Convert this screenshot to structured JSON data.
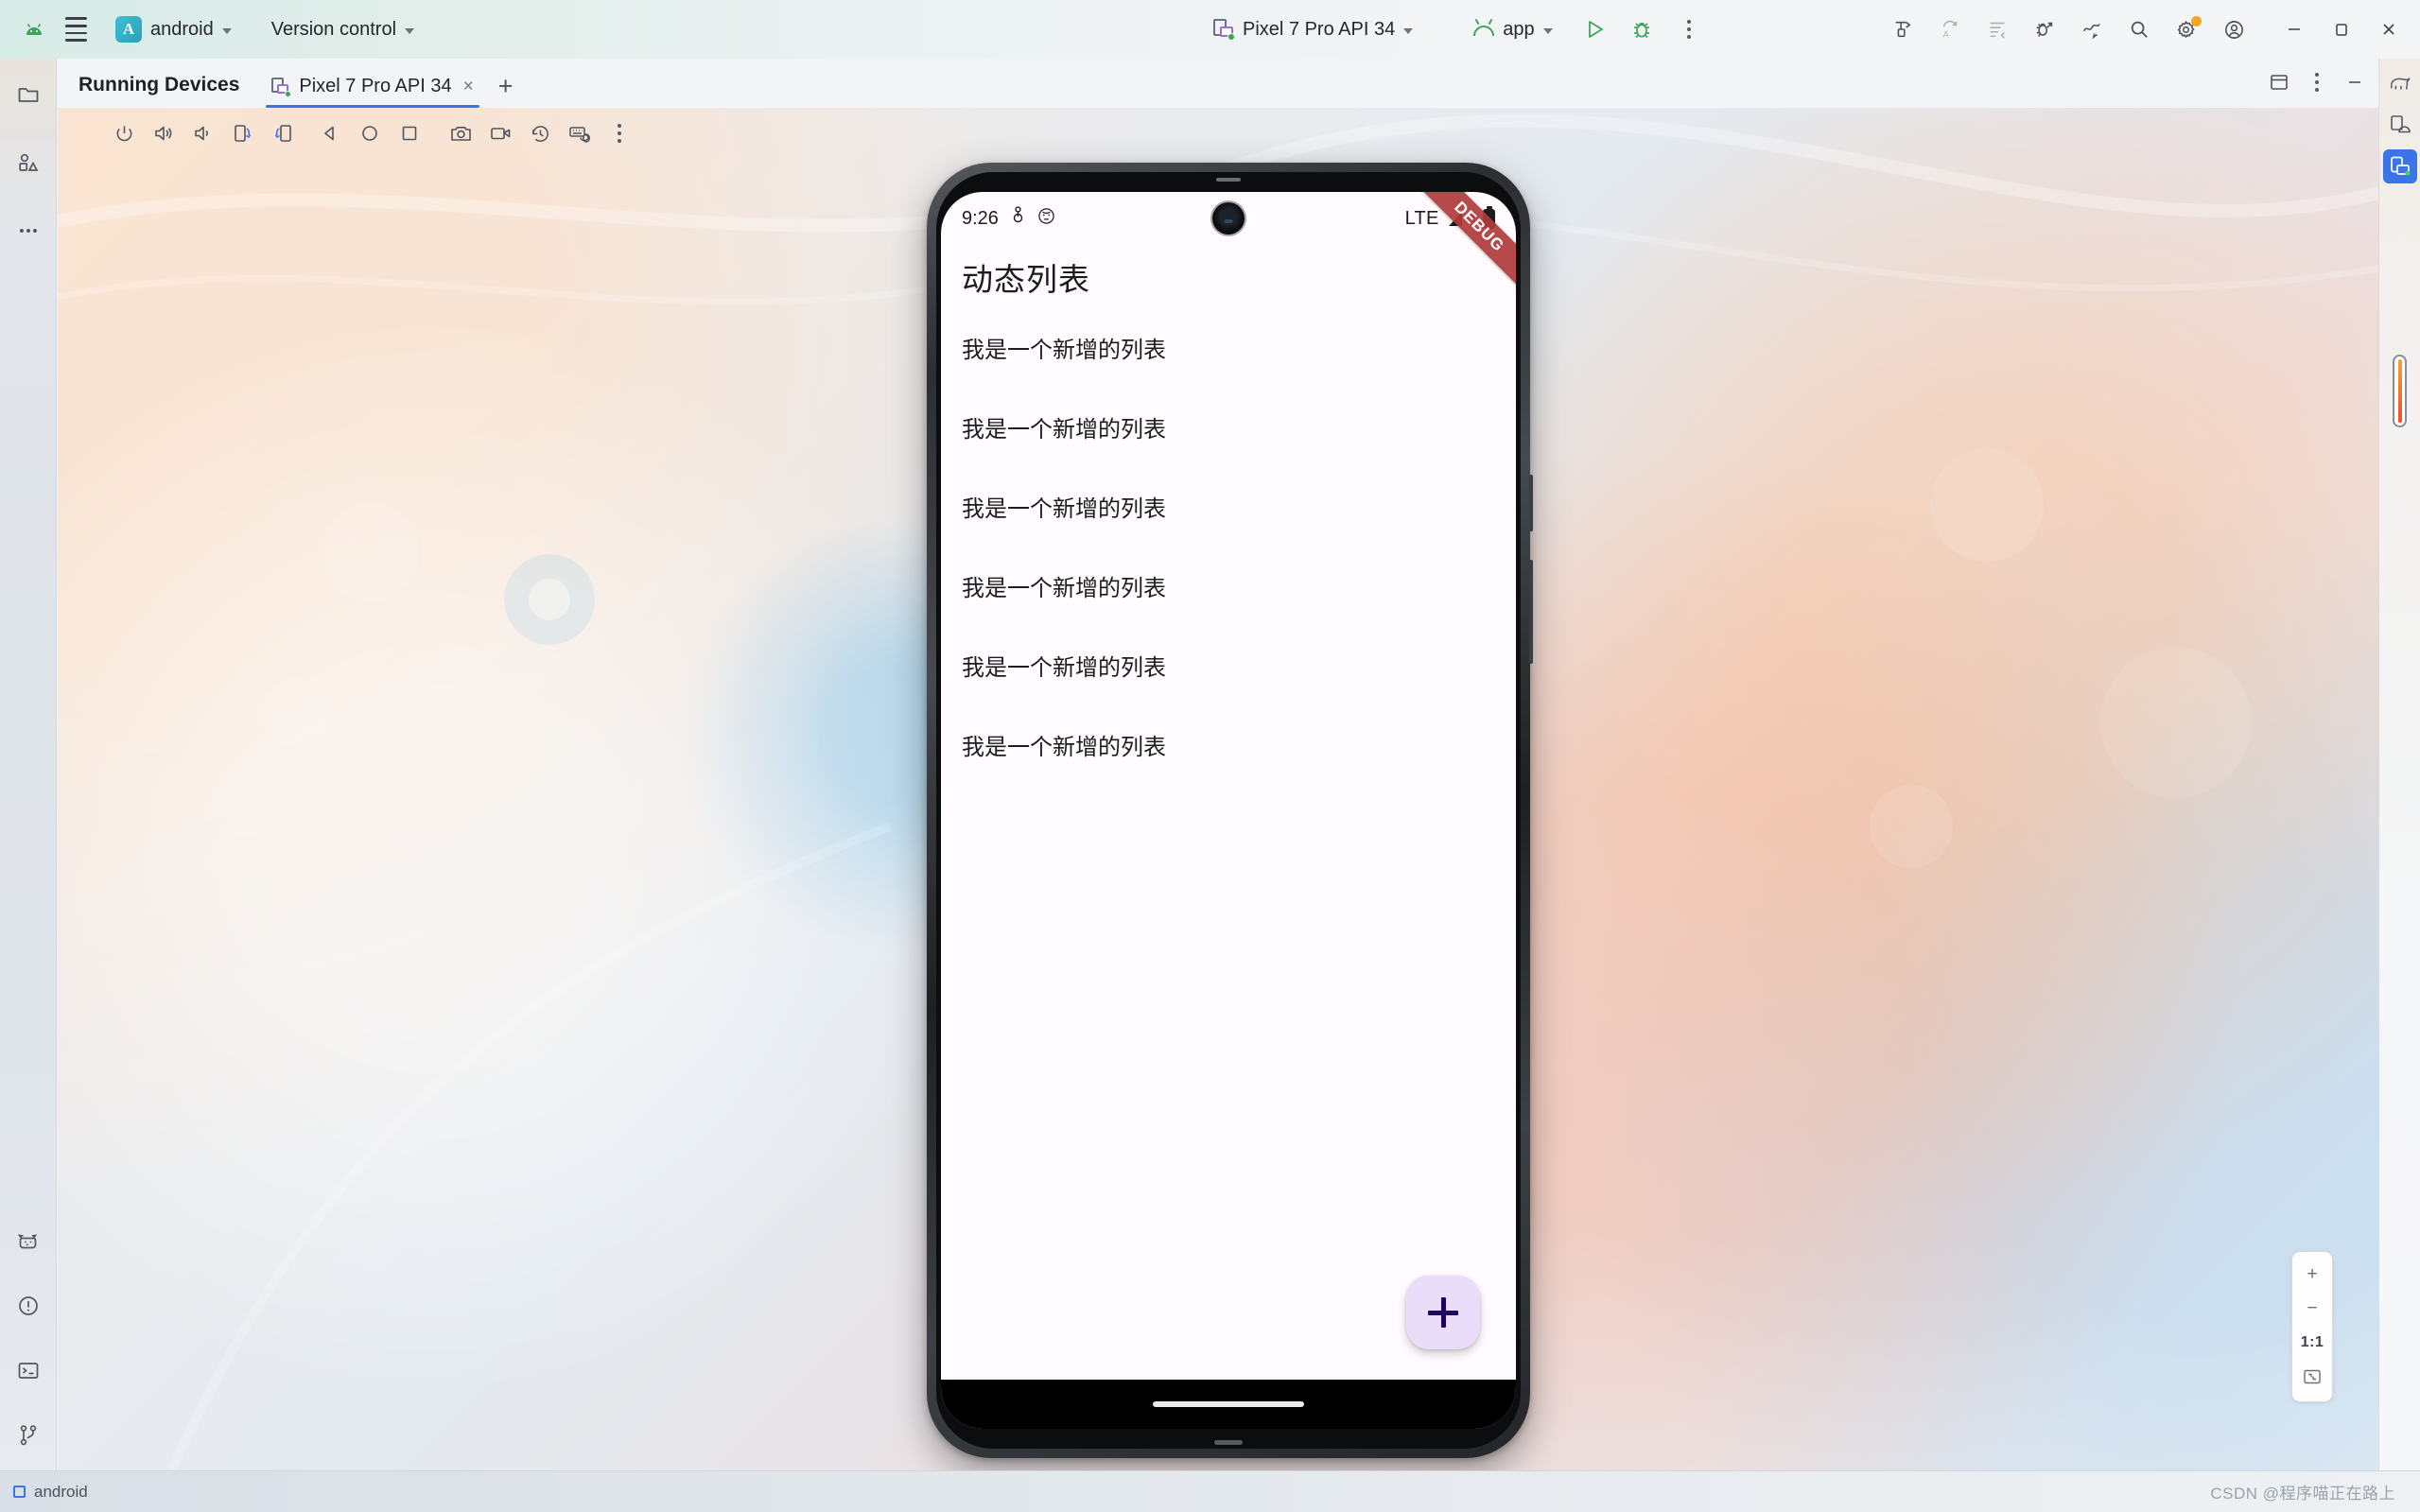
{
  "topbar": {
    "logo_icon": "android-logo-icon",
    "menu_icon": "hamburger-menu-icon",
    "project_badge": "A",
    "project_name": "android",
    "vcs_label": "Version control",
    "run_target": "Pixel 7 Pro API 34",
    "run_config": "app",
    "run_icon": "run-play-icon",
    "debug_icon": "debug-bug-icon",
    "more_icon": "more-vertical-icon",
    "right_icons": [
      "build-hammer-icon",
      "redo-code-icon",
      "code-format-icon",
      "debug-attach-icon",
      "profiler-icon",
      "search-icon",
      "settings-gear-icon",
      "account-avatar-icon"
    ],
    "window_minimize": "minimize-icon",
    "window_maximize": "maximize-icon",
    "window_close": "close-icon"
  },
  "left_sidebar": {
    "items": [
      {
        "name": "project-folder-icon"
      },
      {
        "name": "resource-manager-icon"
      },
      {
        "name": "more-tool-windows-icon"
      }
    ],
    "bottom_items": [
      {
        "name": "logcat-cat-icon"
      },
      {
        "name": "problems-warning-icon"
      },
      {
        "name": "terminal-icon"
      },
      {
        "name": "git-branch-icon"
      }
    ]
  },
  "right_sidebar": {
    "items": [
      {
        "name": "gradle-elephant-icon",
        "active": false
      },
      {
        "name": "device-manager-icon",
        "active": false
      },
      {
        "name": "running-devices-icon",
        "active": true
      }
    ]
  },
  "tabstrip": {
    "title": "Running Devices",
    "tabs": [
      {
        "label": "Pixel 7 Pro API 34",
        "icon": "device-icon",
        "close": "×",
        "active": true
      }
    ],
    "add_tab": "+",
    "right_controls": [
      "split-view-icon",
      "options-kebab-icon",
      "hide-panel-icon"
    ]
  },
  "emulator_toolbar": {
    "buttons": [
      "power-icon",
      "volume-up-icon",
      "volume-down-icon",
      "rotate-right-icon",
      "rotate-left-icon",
      "back-icon",
      "home-icon",
      "overview-icon",
      "screenshot-camera-icon",
      "record-video-icon",
      "snapshot-history-icon",
      "hardware-input-icon",
      "more-options-icon"
    ]
  },
  "device": {
    "status_bar": {
      "time": "9:26",
      "left_icons": [
        "bluetooth-sharing-icon",
        "avatar-face-icon"
      ],
      "network": "LTE",
      "signal_icon": "signal-bars-icon",
      "signal_alert": "!",
      "battery_icon": "battery-icon"
    },
    "debug_ribbon": "DEBUG",
    "app": {
      "title": "动态列表",
      "list_items": [
        "我是一个新增的列表",
        "我是一个新增的列表",
        "我是一个新增的列表",
        "我是一个新增的列表",
        "我是一个新增的列表",
        "我是一个新增的列表"
      ],
      "fab_icon": "add-plus-icon",
      "fab_color": "#e9ddf9",
      "fab_icon_color": "#22005d"
    },
    "nav_pill": "gesture-nav-pill"
  },
  "zoom_controls": {
    "zoom_in": "+",
    "zoom_out": "−",
    "ratio": "1:1",
    "fit_icon": "fit-to-screen-icon"
  },
  "bottom_status": {
    "module_icon": "module-square-icon",
    "module_label": "android",
    "watermark": "CSDN @程序喵正在路上"
  },
  "colors": {
    "accent_blue": "#3b73e8",
    "run_green": "#3ba55d",
    "debug_red": "#b03a3a",
    "badge_orange": "#f5a623"
  }
}
